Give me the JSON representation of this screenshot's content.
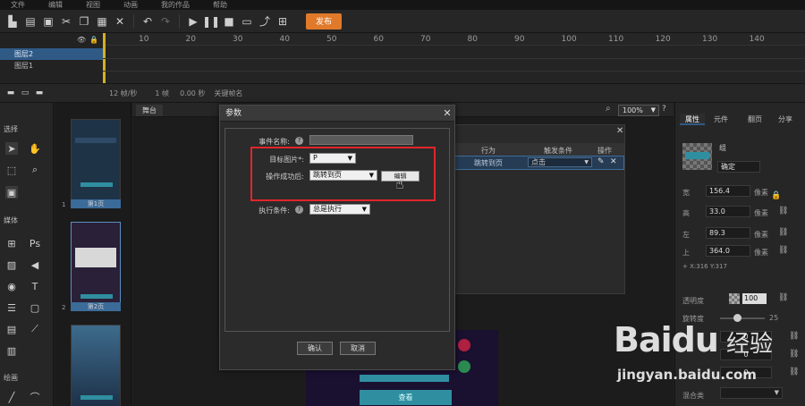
{
  "menubar": {
    "items": [
      "文件",
      "编辑",
      "视图",
      "动画",
      "我的作品",
      "帮助"
    ]
  },
  "toolbar": {
    "publish_label": "发布"
  },
  "timeline": {
    "ruler_ticks": [
      "10",
      "20",
      "30",
      "40",
      "50",
      "60",
      "70",
      "80",
      "90",
      "100",
      "110",
      "120",
      "130",
      "140"
    ],
    "layers": [
      {
        "name": "图层2",
        "active": true
      },
      {
        "name": "图层1",
        "active": false
      }
    ],
    "status": {
      "frame_rate": "12 帧/秒",
      "frame": "1 帧",
      "time": "0.00 秒",
      "keyframe_name": "关键帧名"
    }
  },
  "tools": {
    "section_select": "选择",
    "section_media": "媒体",
    "section_draw": "绘画"
  },
  "pages": [
    {
      "num": "1",
      "label": "第1页"
    },
    {
      "num": "2",
      "label": "第2页"
    }
  ],
  "stage": {
    "tab_label": "舞台",
    "zoom": "100%"
  },
  "props": {
    "tabs": [
      "属性",
      "元件",
      "翻页",
      "分享"
    ],
    "element_name": "组",
    "element_text": "确定",
    "width": {
      "label": "宽",
      "value": "156.4",
      "unit": "像素"
    },
    "height": {
      "label": "高",
      "value": "33.0",
      "unit": "像素"
    },
    "left": {
      "label": "左",
      "value": "89.3",
      "unit": "像素"
    },
    "top": {
      "label": "上",
      "value": "364.0",
      "unit": "像素"
    },
    "coords": "X:316   Y:317",
    "opacity_label": "透明度",
    "opacity_value": "100",
    "rotate_label": "旋转度",
    "rotate_value": "25",
    "value1": "0",
    "value2": "0",
    "value3": "0",
    "blend_label": "混合类"
  },
  "bg_dialog": {
    "columns": [
      "行为",
      "触发条件",
      "操作"
    ],
    "row_action": "跳转到页",
    "row_trigger": "点击"
  },
  "dialog": {
    "title": "参数",
    "event_name_label": "事件名称:",
    "target_image_label": "目标图片*:",
    "target_image_value": "P",
    "success_label": "操作成功后:",
    "success_value": "跳转到页",
    "edit_label": "编辑",
    "condition_label": "执行条件:",
    "condition_value": "总是执行",
    "ok_label": "确认",
    "cancel_label": "取消"
  },
  "stage_button_label": "查看",
  "watermark": {
    "brand": "Baidu",
    "brand_cn": "经验",
    "url": "jingyan.baidu.com"
  },
  "colors": {
    "accent": "#2f5a86",
    "publish": "#e07a2a",
    "highlight": "#e0262a"
  }
}
